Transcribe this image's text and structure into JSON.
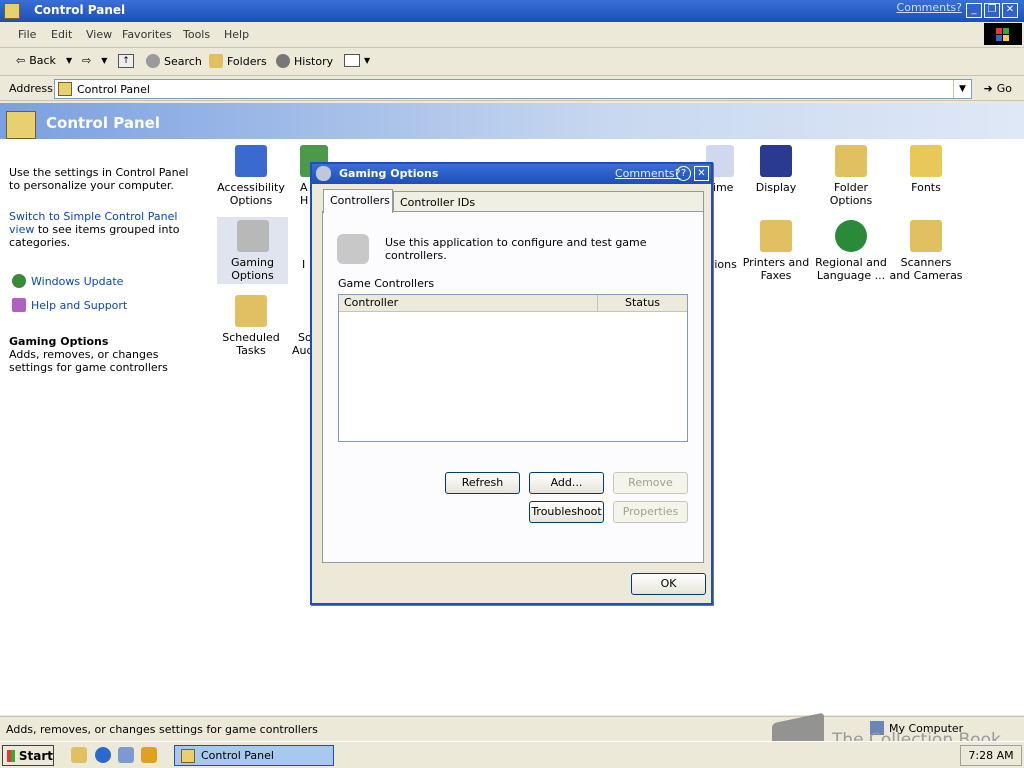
{
  "window": {
    "title": "Control Panel",
    "comments_link": "Comments?"
  },
  "menu": [
    "File",
    "Edit",
    "View",
    "Favorites",
    "Tools",
    "Help"
  ],
  "toolbar": {
    "back": "Back",
    "search": "Search",
    "folders": "Folders",
    "history": "History"
  },
  "address": {
    "label": "Address",
    "value": "Control Panel",
    "go": "Go"
  },
  "banner": {
    "title": "Control Panel"
  },
  "leftpane": {
    "intro": "Use the settings in Control Panel to personalize your computer.",
    "switch_link": "Switch to Simple Control Panel view",
    "switch_rest": "to see items grouped into categories.",
    "windows_update": "Windows Update",
    "help_support": "Help and Support",
    "details_title": "Gaming Options",
    "details_desc": "Adds, removes, or changes settings for game controllers"
  },
  "icons": {
    "accessibility": "Accessibility Options",
    "partial_a": "A",
    "partial_h": "H",
    "time": "Time",
    "display": "Display",
    "folder_options": "Folder Options",
    "fonts": "Fonts",
    "gaming": "Gaming Options",
    "partial_i": "I",
    "options": "tions",
    "printers": "Printers and Faxes",
    "regional": "Regional and Language ...",
    "scanners": "Scanners and Cameras",
    "scheduled": "Scheduled Tasks",
    "partial_so": "So",
    "partial_au": "Aud"
  },
  "dialog": {
    "title": "Gaming Options",
    "comments_link": "Comments?",
    "help": "?",
    "close": "✕",
    "tabs": [
      "Controllers",
      "Controller IDs"
    ],
    "intro": "Use this application to configure and test game controllers.",
    "group_label": "Game Controllers",
    "columns": [
      "Controller",
      "Status"
    ],
    "buttons": {
      "refresh": "Refresh",
      "add": "Add...",
      "remove": "Remove",
      "troubleshoot": "Troubleshoot",
      "properties": "Properties",
      "ok": "OK"
    }
  },
  "statusbar": {
    "message": "Adds, removes, or changes settings for game controllers",
    "zone": "My Computer"
  },
  "watermark": "The Collection Book",
  "taskbar": {
    "start": "Start",
    "task": "Control Panel",
    "clock": "7:28 AM"
  }
}
